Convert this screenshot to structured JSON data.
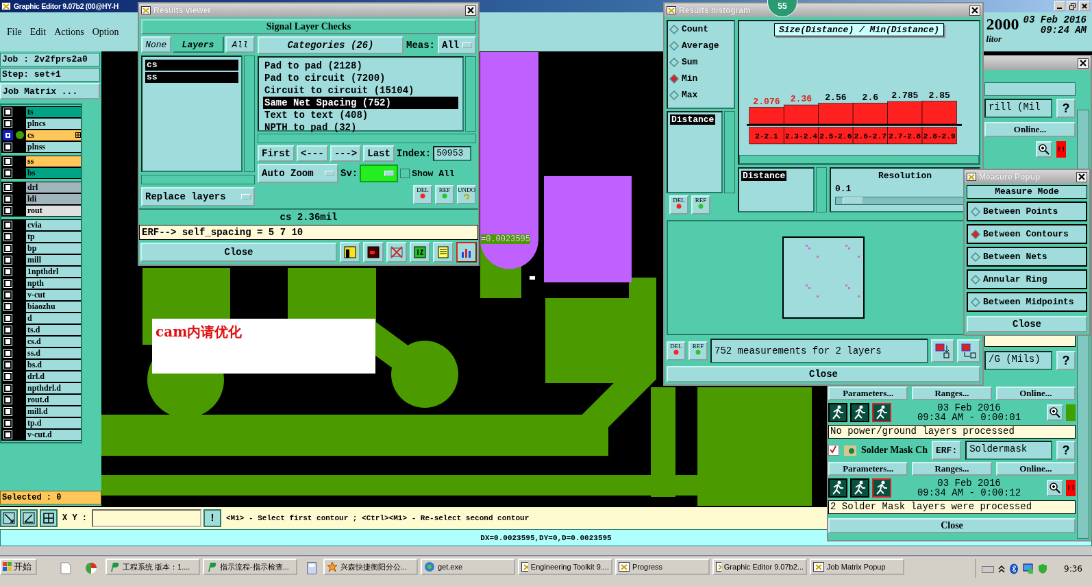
{
  "window": {
    "title": "Graphic Editor 9.07b2 (00@HY-H"
  },
  "menu": [
    "File",
    "Edit",
    "Actions",
    "Option"
  ],
  "date_block": {
    "year": "2000",
    "date": "03 Feb 2016",
    "time": "09:24 AM",
    "subtitle": "litor"
  },
  "job": {
    "job": "Job : 2v2fprs2a0",
    "step": "Step: set+1",
    "matrix_button": "Job Matrix ..."
  },
  "layer_groups": [
    {
      "layers": [
        {
          "name": "ts",
          "color": "#00a383",
          "active": false
        },
        {
          "name": "plncs",
          "color": "#a0dcdc",
          "active": false
        },
        {
          "name": "cs",
          "color": "#ffc65a",
          "active": true
        },
        {
          "name": "plnss",
          "color": "#a0dcdc",
          "active": false
        }
      ]
    },
    {
      "layers": [
        {
          "name": "ss",
          "color": "#ffc65a",
          "active": false
        },
        {
          "name": "bs",
          "color": "#00a383",
          "active": false
        }
      ]
    },
    {
      "layers": [
        {
          "name": "drl",
          "color": "#a0b4bc",
          "active": false
        },
        {
          "name": "ldi",
          "color": "#a0b4bc",
          "active": false
        },
        {
          "name": "rout",
          "color": "#e0e0e0",
          "active": false
        }
      ]
    },
    {
      "layers": [
        {
          "name": "cvia",
          "color": "#a0dcdc",
          "active": false
        },
        {
          "name": "tp",
          "color": "#a0dcdc",
          "active": false
        },
        {
          "name": "bp",
          "color": "#a0dcdc",
          "active": false
        },
        {
          "name": "mill",
          "color": "#a0dcdc",
          "active": false
        },
        {
          "name": "1npthdrl",
          "color": "#a0dcdc",
          "active": false
        },
        {
          "name": "npth",
          "color": "#a0dcdc",
          "active": false
        },
        {
          "name": "v-cut",
          "color": "#a0dcdc",
          "active": false
        },
        {
          "name": "biaozhu",
          "color": "#a0dcdc",
          "active": false
        },
        {
          "name": "d",
          "color": "#a0dcdc",
          "active": false
        },
        {
          "name": "ts.d",
          "color": "#a0dcdc",
          "active": false
        },
        {
          "name": "cs.d",
          "color": "#a0dcdc",
          "active": false
        },
        {
          "name": "ss.d",
          "color": "#a0dcdc",
          "active": false
        },
        {
          "name": "bs.d",
          "color": "#a0dcdc",
          "active": false
        },
        {
          "name": "drl.d",
          "color": "#a0dcdc",
          "active": false
        },
        {
          "name": "npthdrl.d",
          "color": "#a0dcdc",
          "active": false
        },
        {
          "name": "rout.d",
          "color": "#a0dcdc",
          "active": false
        },
        {
          "name": "mill.d",
          "color": "#a0dcdc",
          "active": false
        },
        {
          "name": "tp.d",
          "color": "#a0dcdc",
          "active": false
        },
        {
          "name": "v-cut.d",
          "color": "#a0dcdc",
          "active": false
        }
      ]
    }
  ],
  "selected_count": "Selected : 0",
  "canvas": {
    "note": "cam内请优化",
    "measure_label": "=0.0023595"
  },
  "command_bar": {
    "xy_label": "X Y :",
    "alert": "!",
    "hint": "<M1> - Select first contour ; <Ctrl><M1> - Re-select second contour"
  },
  "status_line": "DX=0.0023595,DY=0,D=0.0023595",
  "results_viewer": {
    "title": "Results viewer",
    "heading": "Signal Layer Checks",
    "layer_filters": [
      {
        "label": "None",
        "selected": false
      },
      {
        "label": "Layers",
        "selected": true
      },
      {
        "label": "All",
        "selected": false
      }
    ],
    "layers": [
      {
        "name": "cs",
        "selected": true
      },
      {
        "name": "ss",
        "selected": true
      }
    ],
    "replace_layers": "Replace layers",
    "categories_title": "Categories (26)",
    "meas_label": "Meas:",
    "meas_value": "All",
    "categories": [
      {
        "label": "Pad to pad (2128)",
        "selected": false
      },
      {
        "label": "Pad to circuit (7200)",
        "selected": false
      },
      {
        "label": "Circuit to circuit (15104)",
        "selected": false
      },
      {
        "label": "Same Net Spacing (752)",
        "selected": true
      },
      {
        "label": "Text to text (408)",
        "selected": false
      },
      {
        "label": "NPTH to pad (32)",
        "selected": false
      }
    ],
    "nav": [
      "First",
      "<---",
      "--->",
      "Last"
    ],
    "index_label": "Index:",
    "index_value": "50953",
    "auto_zoom": "Auto Zoom",
    "sv_label": "Sv:",
    "show_all": {
      "label": "Show All",
      "checked": false
    },
    "tool_buttons": [
      "DEL",
      "REF",
      "UNDO"
    ],
    "result": "cs 2.36mil",
    "erf": "ERF--> self_spacing = 5 7 10",
    "close": "Close"
  },
  "histogram": {
    "title": "Results histogram",
    "badge": "55",
    "modes": [
      {
        "label": "Count",
        "selected": false
      },
      {
        "label": "Average",
        "selected": false
      },
      {
        "label": "Sum",
        "selected": false
      },
      {
        "label": "Min",
        "selected": true
      },
      {
        "label": "Max",
        "selected": false
      }
    ],
    "attribute": "Distance",
    "side_buttons": [
      "DEL",
      "REF"
    ],
    "chart_data": {
      "type": "bar",
      "title": "Size(Distance) / Min(Distance)",
      "categories": [
        "2-2.1",
        "2.3-2.4",
        "2.5-2.6",
        "2.6-2.7",
        "2.7-2.8",
        "2.8-2.9"
      ],
      "series": [
        {
          "color": "#ff2020",
          "values": [
            2.076,
            2.36,
            2.56,
            2.6,
            2.785,
            2.85
          ]
        }
      ],
      "data_labels": true
    },
    "flagged": [
      true,
      true,
      false,
      false,
      false,
      false
    ],
    "list_item": "Distance",
    "resolution_label": "Resolution",
    "resolution_value": "0.1",
    "resolution": {
      "level": 0.05
    },
    "footer_buttons": [
      "DEL",
      "REF"
    ],
    "summary": "752 measurements for 2 layers",
    "close": "Close"
  },
  "checks_panel": {
    "partial_rows": [
      {
        "field": "rill (Mil",
        "help": "?",
        "online": "Online...",
        "color": "#ff0000",
        "status_text": "!!"
      },
      {
        "field": "/G (Mils)",
        "help": "?"
      }
    ],
    "checks": [
      {
        "buttons": [
          "Parameters...",
          "Ranges...",
          "Online..."
        ],
        "date": "03 Feb 2016",
        "time": "09:34 AM - 0:00:01",
        "color": "#40a000",
        "message": "No power/ground layers processed"
      },
      {
        "checked": true,
        "name": "Solder Mask Ch",
        "erf_label": "ERF:",
        "erf_value": "Soldermask",
        "help": "?",
        "buttons": [
          "Parameters...",
          "Ranges...",
          "Online..."
        ],
        "date": "03 Feb 2016",
        "time": "09:34 AM - 0:00:12",
        "color": "#ff0000",
        "status_text": "!!",
        "message": "2 Solder Mask layers were processed"
      }
    ],
    "close": "Close"
  },
  "measure_popup": {
    "title": "Measure Popup",
    "heading": "Measure Mode",
    "modes": [
      {
        "label": "Between Points",
        "selected": false
      },
      {
        "label": "Between Contours",
        "selected": true
      },
      {
        "label": "Between Nets",
        "selected": false
      },
      {
        "label": "Annular Ring",
        "selected": false
      },
      {
        "label": "Between Midpoints",
        "selected": false
      }
    ],
    "close": "Close"
  },
  "taskbar": {
    "start": "开始",
    "items": [
      {
        "label": "工程系统  版本：1....",
        "kind": "p"
      },
      {
        "label": "指示流程-指示检查...",
        "kind": "p"
      },
      {
        "label": "兴森快捷衡阳分公...",
        "kind": "star"
      },
      {
        "label": "get.exe",
        "kind": "globe"
      },
      {
        "label": "Engineering Toolkit 9....",
        "kind": "x"
      },
      {
        "label": "Progress",
        "kind": "x"
      },
      {
        "label": "Graphic Editor 9.07b2...",
        "kind": "x"
      },
      {
        "label": "Job Matrix Popup",
        "kind": "x"
      }
    ],
    "clock": "9:36"
  }
}
